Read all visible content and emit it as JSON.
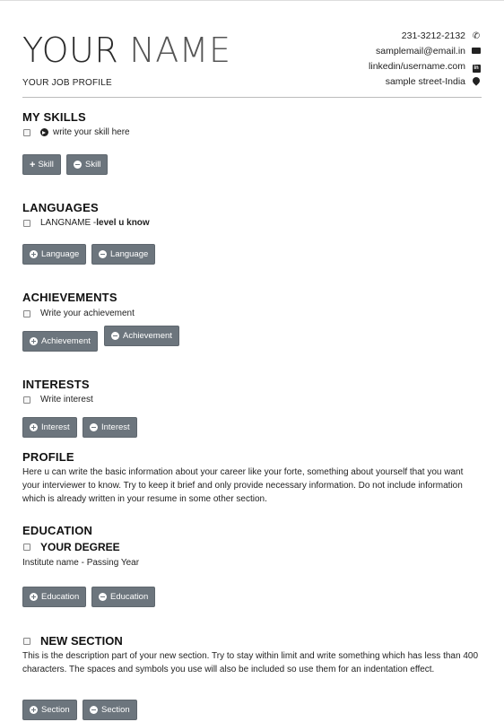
{
  "header": {
    "first_name": "YOUR",
    "last_name": "NAME",
    "job_profile": "YOUR JOB PROFILE",
    "phone": "231-3212-2132",
    "email": "samplemail@email.in",
    "linkedin": "linkedin/username.com",
    "address": "sample street-India"
  },
  "skills": {
    "title": "MY SKILLS",
    "item": "write your skill here",
    "add_label": "Skill",
    "remove_label": "Skill"
  },
  "languages": {
    "title": "LANGUAGES",
    "item_name": "LANGNAME - ",
    "item_level": "level u know",
    "add_label": "Language",
    "remove_label": "Language"
  },
  "achievements": {
    "title": "ACHIEVEMENTS",
    "item": "Write your achievement",
    "add_label": "Achievement",
    "remove_label": "Achievement"
  },
  "interests": {
    "title": "INTERESTS",
    "item": "Write interest",
    "add_label": "Interest",
    "remove_label": "Interest"
  },
  "profile": {
    "title": "PROFILE",
    "text": "Here u can write the basic information about your career like your forte, something about yourself that you want your interviewer to know. Try to keep it brief and only provide necessary information. Do not include information which is already written in your resume in some other section."
  },
  "education": {
    "title": "EDUCATION",
    "degree": "YOUR DEGREE",
    "institute": "Institute name - Passing Year",
    "add_label": "Education",
    "remove_label": "Education"
  },
  "new_section": {
    "title": "NEW SECTION",
    "text": "This is the description part of your new section. Try to stay within limit and write something which has less than 400 characters. The spaces and symbols you use will also be included so use them for an indentation effect.",
    "add_label": "Section",
    "remove_label": "Section"
  },
  "colors": {
    "button_bg": "#6c757d",
    "text": "#222222"
  }
}
